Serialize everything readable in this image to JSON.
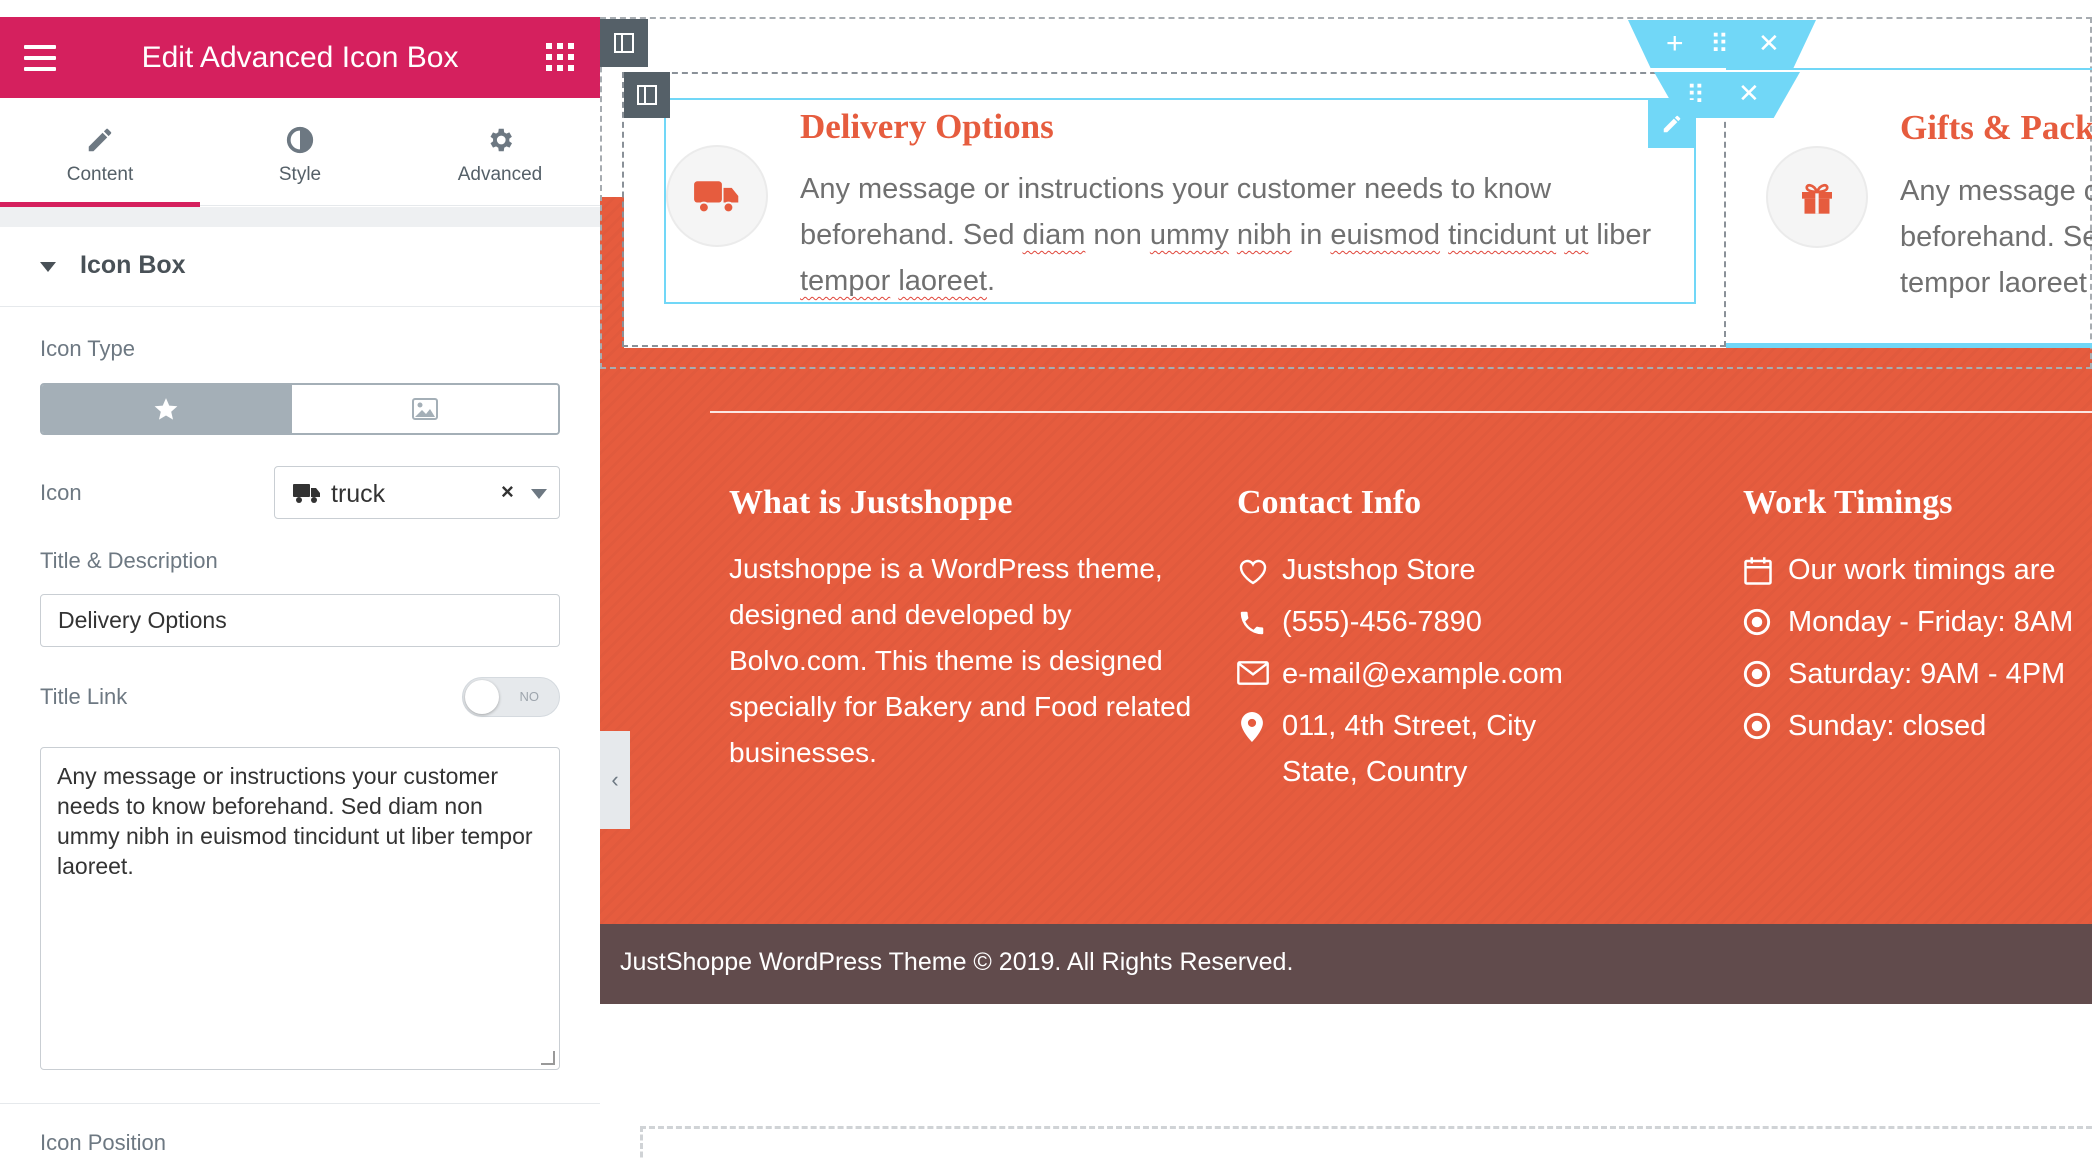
{
  "panel": {
    "title": "Edit Advanced Icon Box",
    "tabs": [
      {
        "label": "Content",
        "icon": "pencil-icon"
      },
      {
        "label": "Style",
        "icon": "half-circle-icon"
      },
      {
        "label": "Advanced",
        "icon": "gear-icon"
      }
    ],
    "active_tab": "Content",
    "section_title": "Icon Box",
    "icon_type_label": "Icon Type",
    "icon_label": "Icon",
    "icon_value": "truck",
    "title_desc_label": "Title & Description",
    "title_value": "Delivery Options",
    "title_link_label": "Title Link",
    "title_link_toggle": "NO",
    "description_value": "Any message or instructions your customer needs to know beforehand. Sed diam non ummy nibh in euismod tincidunt ut liber tempor laoreet.",
    "icon_position_label": "Icon Position"
  },
  "preview": {
    "box1": {
      "title": "Delivery Options",
      "desc_parts": [
        "Any message or instructions your customer needs to know beforehand. Sed ",
        "diam",
        " non ",
        "ummy",
        " ",
        "nibh",
        " in ",
        "euismod",
        " ",
        "tincidunt",
        " ",
        "ut",
        " liber ",
        "tempor",
        " ",
        "laoreet",
        "."
      ]
    },
    "box2": {
      "title": "Gifts & Pack",
      "desc_lines": [
        "Any message c",
        "beforehand. Se",
        "tempor laoreet"
      ]
    },
    "footer": {
      "col1_heading": "What is Justshoppe",
      "col1_text": "Justshoppe is a WordPress theme, designed and developed by Bolvo.com. This theme is designed specially for Bakery and Food related businesses.",
      "col2_heading": "Contact Info",
      "col2_items": [
        "Justshop Store",
        "(555)-456-7890",
        "e-mail@example.com",
        "011, 4th Street, City",
        "State, Country"
      ],
      "col3_heading": "Work Timings",
      "col3_items": [
        "Our work timings are",
        "Monday - Friday: 8AM",
        "Saturday: 9AM - 4PM",
        "Sunday: closed"
      ]
    },
    "copyright": "JustShoppe WordPress Theme © 2019. All Rights Reserved."
  },
  "colors": {
    "brand_pink": "#d5205e",
    "accent_orange": "#e65c3e",
    "footer_bar": "#614b4c",
    "editor_cyan": "#71d7f7"
  }
}
